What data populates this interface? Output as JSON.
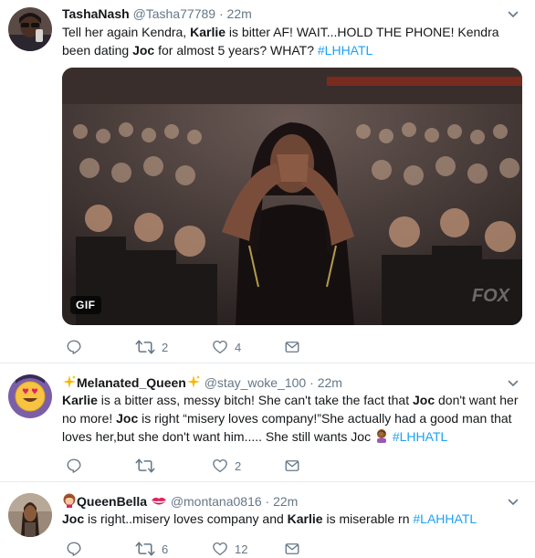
{
  "tweets": [
    {
      "name": "TashaNash",
      "handle": "@Tasha77789",
      "sep": "·",
      "time": "22m",
      "body": [
        {
          "t": "Tell her again Kendra, "
        },
        {
          "b": "Karlie"
        },
        {
          "t": " is bitter AF! WAIT...HOLD THE PHONE! Kendra been dating "
        },
        {
          "b": "Joc"
        },
        {
          "t": " for almost 5 years? WHAT? "
        },
        {
          "h": "#LHHATL"
        }
      ],
      "media": {
        "badge": "GIF",
        "watermark": "FOX"
      },
      "actions": {
        "replies": "",
        "retweets": "2",
        "likes": "4"
      }
    },
    {
      "name": "Melanated_Queen",
      "handle": "@stay_woke_100",
      "sep": "·",
      "time": "22m",
      "body": [
        {
          "b": "Karlie"
        },
        {
          "t": " is a bitter ass, messy bitch! She can't take the fact that "
        },
        {
          "b": "Joc"
        },
        {
          "t": " don't want her no more! "
        },
        {
          "b": "Joc"
        },
        {
          "t": " is right “misery loves company!”She actually had a good man that loves her,but she don't want him..... She still wants Joc "
        },
        {
          "e": "woman-facepalming"
        },
        {
          "t": " "
        },
        {
          "h": "#LHHATL"
        }
      ],
      "actions": {
        "replies": "",
        "retweets": "",
        "likes": "2"
      }
    },
    {
      "name": "QueenBella",
      "handle": "@montana0816",
      "sep": "·",
      "time": "22m",
      "body": [
        {
          "b": "Joc"
        },
        {
          "t": " is right..misery loves company and "
        },
        {
          "b": "Karlie"
        },
        {
          "t": " is miserable rn "
        },
        {
          "h": "#LAHHATL"
        }
      ],
      "actions": {
        "replies": "",
        "retweets": "6",
        "likes": "12"
      }
    }
  ],
  "colors": {
    "accent": "#1da1f2",
    "muted": "#657786",
    "text": "#14171a",
    "divider": "#e6ecf0"
  }
}
